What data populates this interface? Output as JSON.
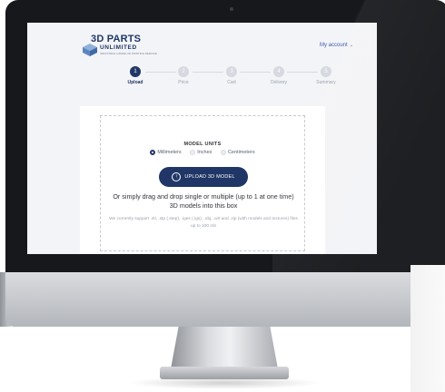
{
  "brand": {
    "name": "3D PARTS",
    "sub": "UNLIMITED",
    "tagline": "INDUSTRIAL GRADE 3D PRINTING SERVICE"
  },
  "header": {
    "account_label": "My account"
  },
  "steps": [
    {
      "number": "1",
      "label": "Upload",
      "active": true
    },
    {
      "number": "2",
      "label": "Price",
      "active": false
    },
    {
      "number": "3",
      "label": "Cart",
      "active": false
    },
    {
      "number": "4",
      "label": "Delivery",
      "active": false
    },
    {
      "number": "5",
      "label": "Summary",
      "active": false
    }
  ],
  "upload": {
    "units_title": "MODEL UNITS",
    "units": [
      {
        "label": "Millimeters",
        "checked": true
      },
      {
        "label": "Inches",
        "checked": false
      },
      {
        "label": "Centimeters",
        "checked": false
      }
    ],
    "button_label": "UPLOAD 3D MODEL",
    "drag_text": "Or simply drag and drop single or multiple (up to 1 at one time) 3D models into this box",
    "support_text": "We currently support .stl, .stp (.step), .iges (.igs), .obj, .wrl and .zip (with models and textures) files up to 100 mb"
  },
  "colors": {
    "brand_navy": "#1f3666",
    "link_blue": "#3d5bb0",
    "step_inactive": "#d6d9df"
  }
}
